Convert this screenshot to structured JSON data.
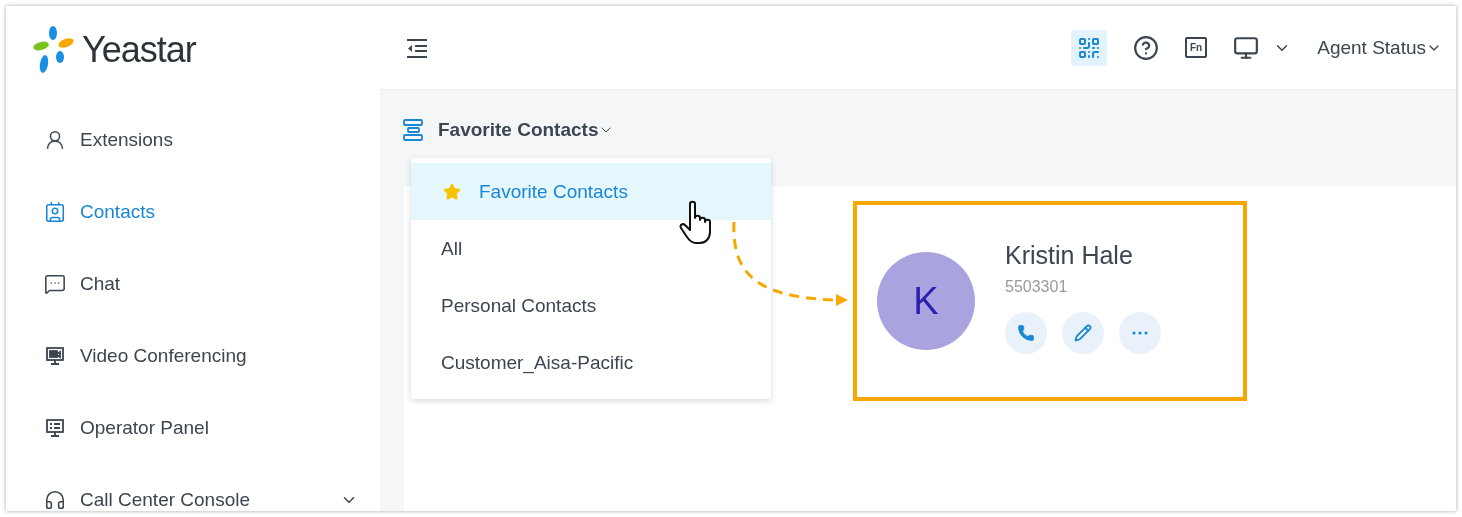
{
  "logo": {
    "text": "Yeastar"
  },
  "sidebar": {
    "items": [
      {
        "label": "Extensions",
        "kind": "extensions",
        "selected": false,
        "expandable": false
      },
      {
        "label": "Contacts",
        "kind": "contacts",
        "selected": true,
        "expandable": false
      },
      {
        "label": "Chat",
        "kind": "chat",
        "selected": false,
        "expandable": false
      },
      {
        "label": "Video Conferencing",
        "kind": "video",
        "selected": false,
        "expandable": false
      },
      {
        "label": "Operator Panel",
        "kind": "operator",
        "selected": false,
        "expandable": false
      },
      {
        "label": "Call Center Console",
        "kind": "callcenter",
        "selected": false,
        "expandable": true
      }
    ]
  },
  "header": {
    "fn_label": "Fn",
    "agent_status": "Agent Status"
  },
  "contact_group": {
    "label": "Favorite Contacts",
    "expanded": true
  },
  "dropdown": {
    "items": [
      {
        "label": "Favorite Contacts",
        "selected": true,
        "starred": true
      },
      {
        "label": "All",
        "selected": false,
        "starred": false
      },
      {
        "label": "Personal Contacts",
        "selected": false,
        "starred": false
      },
      {
        "label": "Customer_Aisa-Pacific",
        "selected": false,
        "starred": false
      }
    ]
  },
  "contact_card": {
    "initial": "K",
    "name": "Kristin Hale",
    "number": "5503301",
    "color": "#a9a3df",
    "highlighted": true
  }
}
